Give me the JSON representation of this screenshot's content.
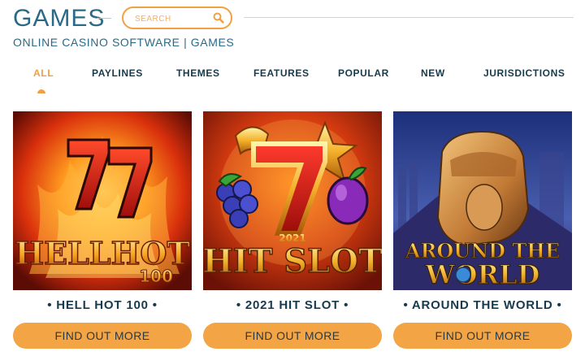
{
  "header": {
    "title": "GAMES",
    "subtitle": "ONLINE CASINO SOFTWARE | GAMES",
    "search": {
      "placeholder": "SEARCH",
      "value": "",
      "icon": "search-icon"
    }
  },
  "nav": {
    "items": [
      {
        "label": "ALL",
        "active": true
      },
      {
        "label": "PAYLINES"
      },
      {
        "label": "THEMES"
      },
      {
        "label": "FEATURES"
      },
      {
        "label": "POPULAR"
      },
      {
        "label": "NEW"
      },
      {
        "label": "JURISDICTIONS"
      }
    ]
  },
  "games": [
    {
      "title": "• HELL HOT 100 •",
      "button": "FIND OUT MORE",
      "art": {
        "logo_line1": "HELL HOT",
        "logo_line2": "100",
        "symbol": "77"
      }
    },
    {
      "title": "• 2021 HIT SLOT •",
      "button": "FIND OUT MORE",
      "art": {
        "logo_year": "2021",
        "logo_text": "HIT SLOT",
        "symbol": "7"
      }
    },
    {
      "title": "• AROUND THE WORLD •",
      "button": "FIND OUT MORE",
      "art": {
        "logo_line1": "AROUND THE",
        "logo_line2": "WORLD"
      }
    }
  ],
  "colors": {
    "accent": "#f0a040",
    "button": "#f3a445",
    "heading": "#2b6a86",
    "text": "#173a4d"
  }
}
